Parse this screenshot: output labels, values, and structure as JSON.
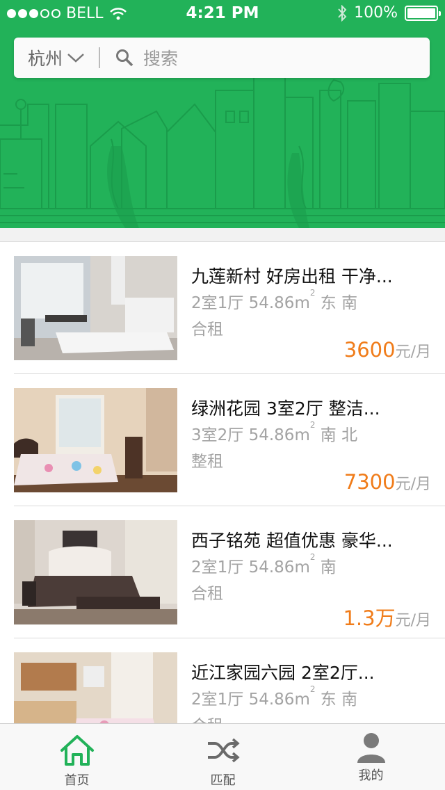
{
  "status_bar": {
    "carrier": "BELL",
    "time": "4:21 PM",
    "battery": "100%"
  },
  "search": {
    "city": "杭州",
    "placeholder": "搜索"
  },
  "listings": [
    {
      "title": "九莲新村 好房出租 干净...",
      "layout": "2室1厅",
      "area": "54.86m",
      "area_sup": "2",
      "orientation": "东 南",
      "rent_type": "合租",
      "price": "3600",
      "price_unit": "元/月"
    },
    {
      "title": "绿洲花园 3室2厅 整洁...",
      "layout": "3室2厅",
      "area": "54.86m",
      "area_sup": "2",
      "orientation": "南 北",
      "rent_type": "整租",
      "price": "7300",
      "price_unit": "元/月"
    },
    {
      "title": "西子铭苑 超值优惠 豪华...",
      "layout": "2室1厅",
      "area": "54.86m",
      "area_sup": "2",
      "orientation": "南",
      "rent_type": "合租",
      "price": "1.3万",
      "price_unit": "元/月"
    },
    {
      "title": "近江家园六园 2室2厅...",
      "layout": "2室1厅",
      "area": "54.86m",
      "area_sup": "2",
      "orientation": "东 南",
      "rent_type": "合租",
      "price": "",
      "price_unit": ""
    }
  ],
  "tabs": [
    {
      "label": "首页",
      "icon": "home-icon",
      "active": true
    },
    {
      "label": "匹配",
      "icon": "shuffle-icon",
      "active": false
    },
    {
      "label": "我的",
      "icon": "user-icon",
      "active": false
    }
  ],
  "colors": {
    "brand_green": "#22b259",
    "price_orange": "#f07c1a"
  }
}
